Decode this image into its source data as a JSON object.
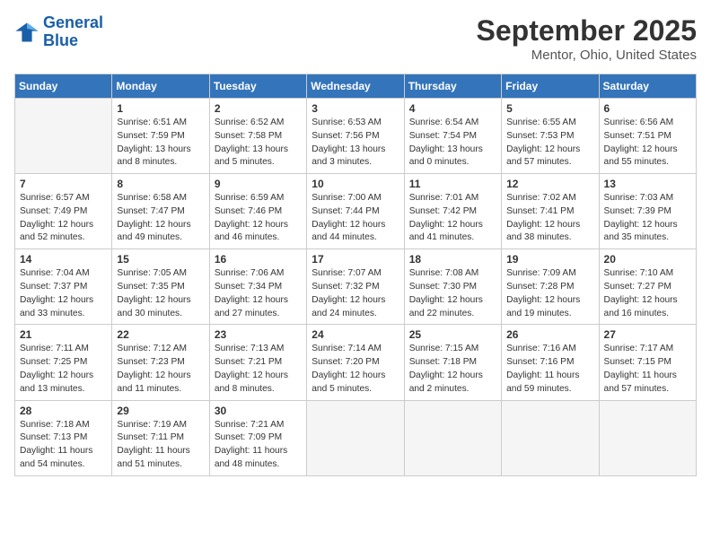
{
  "header": {
    "logo_line1": "General",
    "logo_line2": "Blue",
    "month": "September 2025",
    "location": "Mentor, Ohio, United States"
  },
  "days_of_week": [
    "Sunday",
    "Monday",
    "Tuesday",
    "Wednesday",
    "Thursday",
    "Friday",
    "Saturday"
  ],
  "weeks": [
    [
      {
        "day": "",
        "info": ""
      },
      {
        "day": "1",
        "info": "Sunrise: 6:51 AM\nSunset: 7:59 PM\nDaylight: 13 hours\nand 8 minutes."
      },
      {
        "day": "2",
        "info": "Sunrise: 6:52 AM\nSunset: 7:58 PM\nDaylight: 13 hours\nand 5 minutes."
      },
      {
        "day": "3",
        "info": "Sunrise: 6:53 AM\nSunset: 7:56 PM\nDaylight: 13 hours\nand 3 minutes."
      },
      {
        "day": "4",
        "info": "Sunrise: 6:54 AM\nSunset: 7:54 PM\nDaylight: 13 hours\nand 0 minutes."
      },
      {
        "day": "5",
        "info": "Sunrise: 6:55 AM\nSunset: 7:53 PM\nDaylight: 12 hours\nand 57 minutes."
      },
      {
        "day": "6",
        "info": "Sunrise: 6:56 AM\nSunset: 7:51 PM\nDaylight: 12 hours\nand 55 minutes."
      }
    ],
    [
      {
        "day": "7",
        "info": "Sunrise: 6:57 AM\nSunset: 7:49 PM\nDaylight: 12 hours\nand 52 minutes."
      },
      {
        "day": "8",
        "info": "Sunrise: 6:58 AM\nSunset: 7:47 PM\nDaylight: 12 hours\nand 49 minutes."
      },
      {
        "day": "9",
        "info": "Sunrise: 6:59 AM\nSunset: 7:46 PM\nDaylight: 12 hours\nand 46 minutes."
      },
      {
        "day": "10",
        "info": "Sunrise: 7:00 AM\nSunset: 7:44 PM\nDaylight: 12 hours\nand 44 minutes."
      },
      {
        "day": "11",
        "info": "Sunrise: 7:01 AM\nSunset: 7:42 PM\nDaylight: 12 hours\nand 41 minutes."
      },
      {
        "day": "12",
        "info": "Sunrise: 7:02 AM\nSunset: 7:41 PM\nDaylight: 12 hours\nand 38 minutes."
      },
      {
        "day": "13",
        "info": "Sunrise: 7:03 AM\nSunset: 7:39 PM\nDaylight: 12 hours\nand 35 minutes."
      }
    ],
    [
      {
        "day": "14",
        "info": "Sunrise: 7:04 AM\nSunset: 7:37 PM\nDaylight: 12 hours\nand 33 minutes."
      },
      {
        "day": "15",
        "info": "Sunrise: 7:05 AM\nSunset: 7:35 PM\nDaylight: 12 hours\nand 30 minutes."
      },
      {
        "day": "16",
        "info": "Sunrise: 7:06 AM\nSunset: 7:34 PM\nDaylight: 12 hours\nand 27 minutes."
      },
      {
        "day": "17",
        "info": "Sunrise: 7:07 AM\nSunset: 7:32 PM\nDaylight: 12 hours\nand 24 minutes."
      },
      {
        "day": "18",
        "info": "Sunrise: 7:08 AM\nSunset: 7:30 PM\nDaylight: 12 hours\nand 22 minutes."
      },
      {
        "day": "19",
        "info": "Sunrise: 7:09 AM\nSunset: 7:28 PM\nDaylight: 12 hours\nand 19 minutes."
      },
      {
        "day": "20",
        "info": "Sunrise: 7:10 AM\nSunset: 7:27 PM\nDaylight: 12 hours\nand 16 minutes."
      }
    ],
    [
      {
        "day": "21",
        "info": "Sunrise: 7:11 AM\nSunset: 7:25 PM\nDaylight: 12 hours\nand 13 minutes."
      },
      {
        "day": "22",
        "info": "Sunrise: 7:12 AM\nSunset: 7:23 PM\nDaylight: 12 hours\nand 11 minutes."
      },
      {
        "day": "23",
        "info": "Sunrise: 7:13 AM\nSunset: 7:21 PM\nDaylight: 12 hours\nand 8 minutes."
      },
      {
        "day": "24",
        "info": "Sunrise: 7:14 AM\nSunset: 7:20 PM\nDaylight: 12 hours\nand 5 minutes."
      },
      {
        "day": "25",
        "info": "Sunrise: 7:15 AM\nSunset: 7:18 PM\nDaylight: 12 hours\nand 2 minutes."
      },
      {
        "day": "26",
        "info": "Sunrise: 7:16 AM\nSunset: 7:16 PM\nDaylight: 11 hours\nand 59 minutes."
      },
      {
        "day": "27",
        "info": "Sunrise: 7:17 AM\nSunset: 7:15 PM\nDaylight: 11 hours\nand 57 minutes."
      }
    ],
    [
      {
        "day": "28",
        "info": "Sunrise: 7:18 AM\nSunset: 7:13 PM\nDaylight: 11 hours\nand 54 minutes."
      },
      {
        "day": "29",
        "info": "Sunrise: 7:19 AM\nSunset: 7:11 PM\nDaylight: 11 hours\nand 51 minutes."
      },
      {
        "day": "30",
        "info": "Sunrise: 7:21 AM\nSunset: 7:09 PM\nDaylight: 11 hours\nand 48 minutes."
      },
      {
        "day": "",
        "info": ""
      },
      {
        "day": "",
        "info": ""
      },
      {
        "day": "",
        "info": ""
      },
      {
        "day": "",
        "info": ""
      }
    ]
  ]
}
